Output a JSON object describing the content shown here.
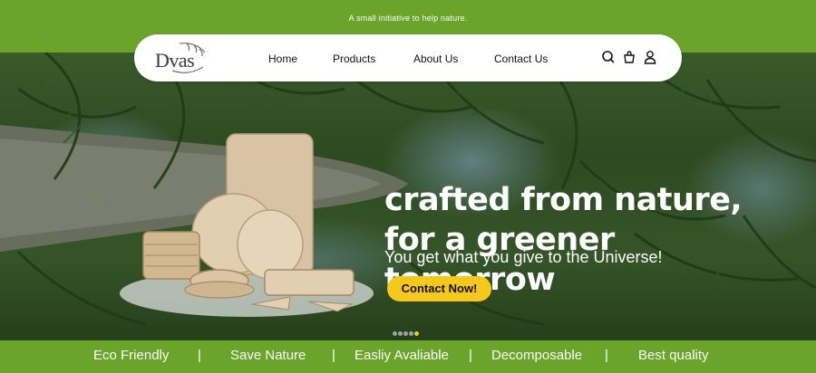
{
  "announcement": "A small initiative to help nature.",
  "brand": {
    "name": "Dvas"
  },
  "nav": {
    "links": [
      "Home",
      "Products",
      "About Us",
      "Contact Us"
    ],
    "icons": [
      "search-icon",
      "cart-icon",
      "user-icon"
    ]
  },
  "hero": {
    "headline": [
      "crafted from nature,",
      "for a greener",
      "tomorrow"
    ],
    "subline": "You get what you give to the Universe!",
    "cta": "Contact Now!",
    "slides": {
      "count": 5,
      "active_index": 4
    }
  },
  "features": [
    "Eco Friendly",
    "|",
    "Save Nature",
    "|",
    "Easliy Avaliable",
    "|",
    "Decomposable",
    "|",
    "Best quality"
  ],
  "colors": {
    "brand_green": "#6aa42a",
    "cta_yellow": "#f6c81b",
    "text_dark": "#111111"
  }
}
